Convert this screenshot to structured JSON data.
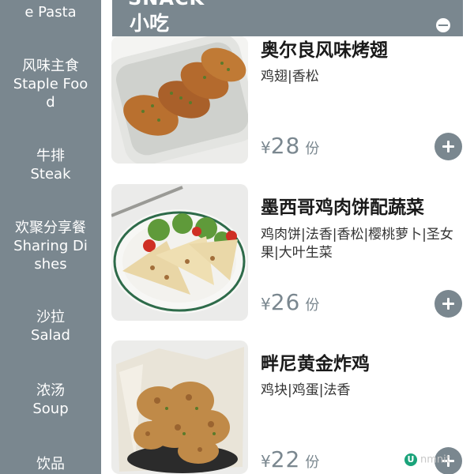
{
  "sidebar": {
    "items": [
      {
        "cn": "",
        "en": "e Pasta"
      },
      {
        "cn": "风味主食",
        "en": "Staple Food"
      },
      {
        "cn": "牛排",
        "en": "Steak"
      },
      {
        "cn": "欢聚分享餐",
        "en": "Sharing Dishes"
      },
      {
        "cn": "沙拉",
        "en": "Salad"
      },
      {
        "cn": "浓汤",
        "en": "Soup"
      },
      {
        "cn": "饮品",
        "en": ""
      }
    ]
  },
  "category": {
    "en": "SNACK",
    "cn": "小吃"
  },
  "dishes": [
    {
      "name": "奥尔良风味烤翅",
      "desc": "鸡翅|香松",
      "currency": "¥",
      "price": "28",
      "unit": "份",
      "image": "roasted-wings-image"
    },
    {
      "name": "墨西哥鸡肉饼配蔬菜",
      "desc": "鸡肉饼|法香|香松|樱桃萝卜|圣女果|大叶生菜",
      "currency": "¥",
      "price": "26",
      "unit": "份",
      "image": "chicken-quesadilla-image"
    },
    {
      "name": "畔尼黄金炸鸡",
      "desc": "鸡块|鸡蛋|法香",
      "currency": "¥",
      "price": "22",
      "unit": "份",
      "image": "fried-chicken-image"
    }
  ],
  "watermark": {
    "badge": "U",
    "text": "nmnit"
  },
  "colors": {
    "accent": "#7a878f",
    "text": "#1a1a1a",
    "background": "#ffffff"
  },
  "icons": {
    "collapse": "collapse-icon",
    "add": "plus-icon"
  }
}
